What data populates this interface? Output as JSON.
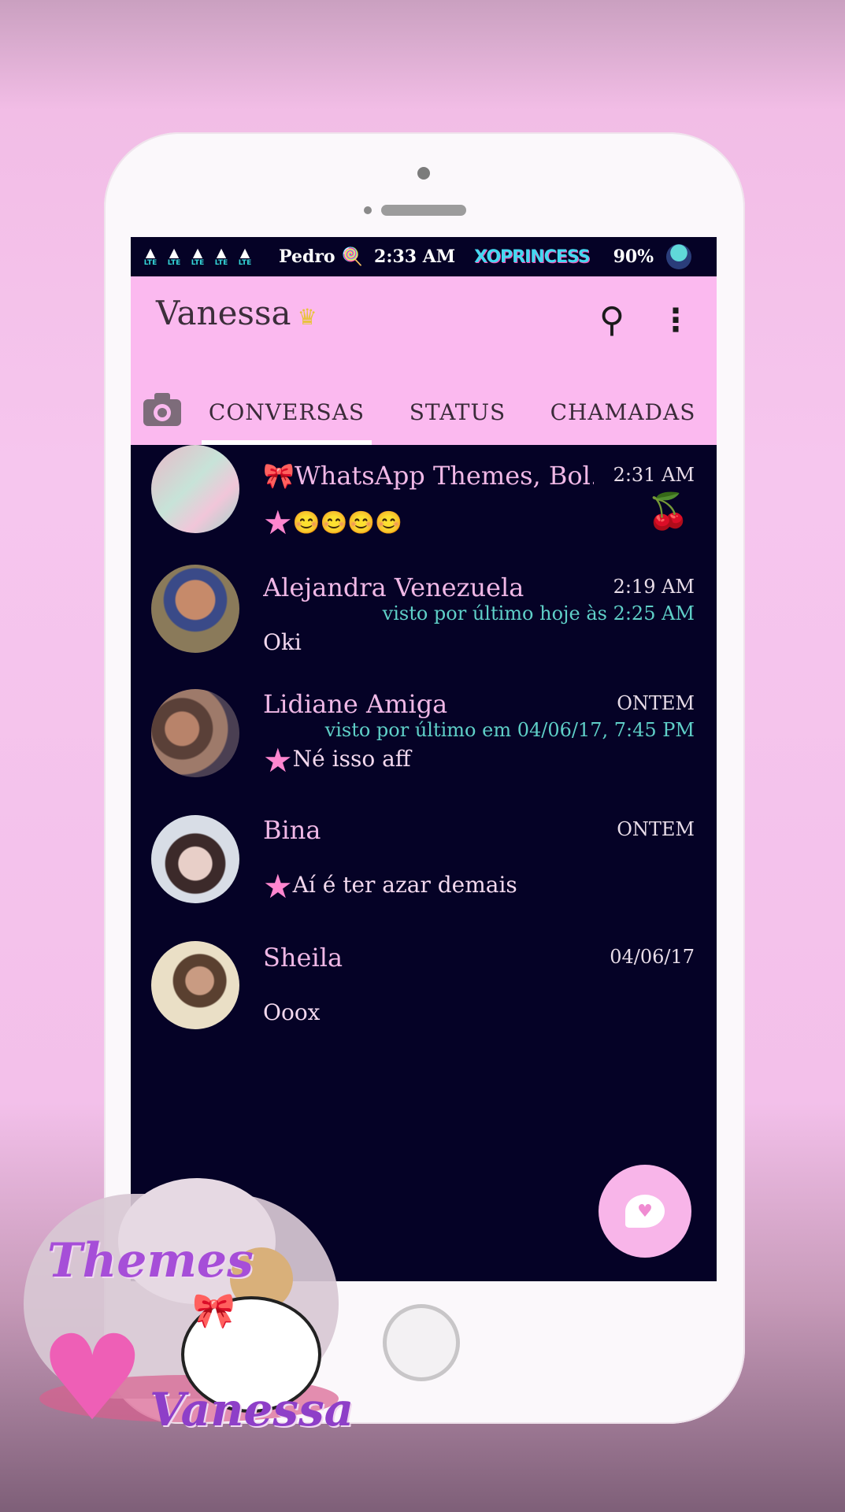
{
  "statusbar": {
    "lte_labels": [
      "LTE",
      "LTE",
      "LTE",
      "LTE",
      "LTE"
    ],
    "carrier": "Pedro",
    "time": "2:33 AM",
    "brand": "XOPRINCESS",
    "battery": "90%"
  },
  "appbar": {
    "title": "Vanessa",
    "title_icon": "crown-icon"
  },
  "tabs": [
    {
      "label": "CONVERSAS",
      "active": true
    },
    {
      "label": "STATUS",
      "active": false
    },
    {
      "label": "CHAMADAS",
      "active": false
    }
  ],
  "chats": [
    {
      "name": "🎀WhatsApp Themes, Bol...",
      "time": "2:31 AM",
      "seen": "",
      "message": "😊😊😊😊",
      "message_prefix_icon": "star-icon",
      "muted_icon": "cherry-icon"
    },
    {
      "name": "Alejandra Venezuela",
      "time": "2:19 AM",
      "seen": "visto por último hoje às 2:25 AM",
      "message": "Oki",
      "message_prefix_icon": ""
    },
    {
      "name": "Lidiane Amiga",
      "time": "ONTEM",
      "seen": "visto por último em 04/06/17, 7:45 PM",
      "message": "Né isso aff",
      "message_prefix_icon": "star-icon"
    },
    {
      "name": "Bina",
      "time": "ONTEM",
      "seen": "",
      "message": "Aí é ter azar demais",
      "message_prefix_icon": "star-icon"
    },
    {
      "name": "Sheila",
      "time": "04/06/17",
      "seen": "",
      "message": "Ooox",
      "message_prefix_icon": ""
    }
  ],
  "sticker": {
    "line1": "Themes",
    "line2": "Vanessa"
  },
  "colors": {
    "appbar": "#fbb9ef",
    "screen_bg": "#050226",
    "name_text": "#f0b8e6",
    "seen_text": "#5fd0c8",
    "accent": "#ff86cf"
  }
}
